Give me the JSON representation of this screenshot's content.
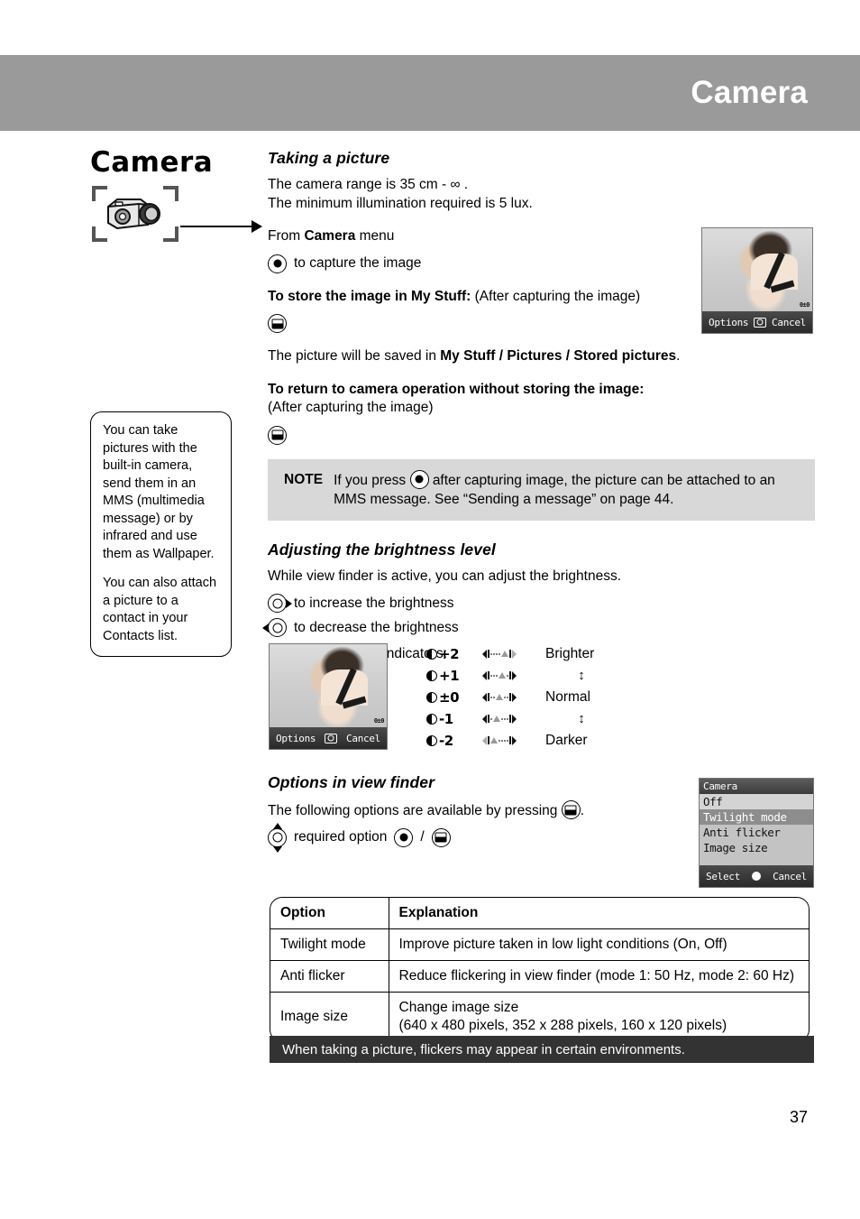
{
  "header": {
    "title": "Camera"
  },
  "left": {
    "chapter_title": "Camera",
    "camera_icon": "camera-icon",
    "callout": {
      "paragraph1": "You can take pictures with the built-in camera, send them in an MMS (multimedia message) or by infrared and use them as Wallpaper.",
      "paragraph2": "You can also attach a picture to a contact in your Contacts list."
    }
  },
  "sections": {
    "taking_a_picture": {
      "heading": "Taking a picture",
      "line1": "The camera range is 35 cm - ∞ .",
      "line2": "The minimum illumination required is 5 lux.",
      "from_menu_pre": "From ",
      "from_menu_bold": "Camera",
      "from_menu_post": " menu",
      "capture_text": "to capture the image",
      "store_bold": "To store the image in My Stuff:",
      "store_rest": " (After capturing the image)",
      "saved_pre": "The picture will be saved in ",
      "saved_bold1": "My Stuff / Pictures / Stored pictures",
      "saved_post": ".",
      "return_bold": "To return to camera operation without storing the image:",
      "return_sub": "(After capturing the image)"
    },
    "note": {
      "label": "NOTE",
      "text_before_key": "If you press",
      "text_after_key": "after capturing image, the picture can be attached to an MMS message. See “Sending a message” on page 44."
    },
    "brightness": {
      "heading": "Adjusting the brightness level",
      "intro": "While view finder is active, you can adjust the brightness.",
      "increase": "to increase the brightness",
      "decrease": "to decrease the brightness",
      "indicators_label": "Picture brightness indicators:",
      "levels": [
        {
          "value": "+2",
          "label": "Brighter",
          "pos": 4
        },
        {
          "value": "+1",
          "label": "↕",
          "pos": 3
        },
        {
          "value": "±0",
          "label": "Normal",
          "pos": 2
        },
        {
          "value": "-1",
          "label": "↕",
          "pos": 1
        },
        {
          "value": "-2",
          "label": "Darker",
          "pos": 0
        }
      ]
    },
    "options_view_finder": {
      "heading": "Options in view finder",
      "intro_before_key": "The following options are available by pressing",
      "intro_after_key": ".",
      "select_text": "required option",
      "select_sep": "/"
    }
  },
  "phone_viewfinder": {
    "left_softkey": "Options",
    "center_icon": "camera-icon",
    "right_softkey": "Cancel",
    "brightness_overlay": "0±0"
  },
  "phone_menu": {
    "title": "Camera",
    "items": [
      "Off",
      "Twilight mode",
      "Anti flicker",
      "Image size"
    ],
    "highlighted": "Twilight mode",
    "left_softkey": "Select",
    "center_icon": "circle-icon",
    "right_softkey": "Cancel"
  },
  "options_table": {
    "headers": [
      "Option",
      "Explanation"
    ],
    "rows": [
      {
        "option": "Twilight mode",
        "explanation": "Improve picture taken in low light conditions (On, Off)"
      },
      {
        "option": "Anti flicker",
        "explanation": "Reduce flickering in view finder (mode 1: 50 Hz, mode 2: 60 Hz)"
      },
      {
        "option": "Image size",
        "explanation_line1": "Change image size",
        "explanation_line2": "(640 x 480 pixels, 352 x 288 pixels, 160 x 120 pixels)"
      }
    ]
  },
  "bottom_bar": {
    "text": "When taking a picture, flickers may appear in certain environments."
  },
  "footer": {
    "page_number": "37"
  },
  "colors": {
    "header_band": "#9a9a9a",
    "note_bg": "#d8d8d8",
    "bottom_bar_bg": "#333333",
    "menu_highlight": "#8d8d8d"
  }
}
